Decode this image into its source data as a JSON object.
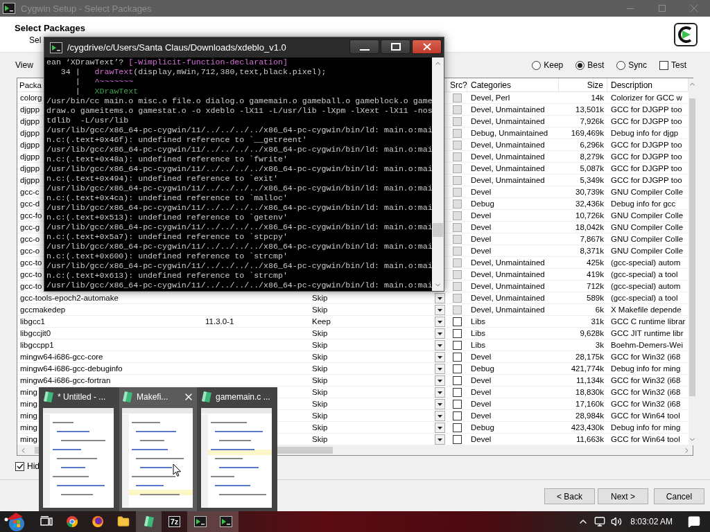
{
  "background_window": {
    "title": "Cygwin Setup - Select Packages"
  },
  "header": {
    "title": "Select Packages",
    "subtitle": "Sel"
  },
  "view_label": "View",
  "modes": [
    {
      "label": "Keep",
      "selected": false
    },
    {
      "label": "Best",
      "selected": true
    },
    {
      "label": "Sync",
      "selected": false
    }
  ],
  "test": {
    "label": "Test",
    "checked": false
  },
  "table": {
    "columns": [
      "Packa",
      "Src?",
      "Categories",
      "Size",
      "Description"
    ],
    "rows": [
      {
        "package": "colorg",
        "disabled": true,
        "category": "Devel, Perl",
        "size": "14k",
        "description": "Colorizer for GCC w"
      },
      {
        "package": "djgpp",
        "disabled": true,
        "category": "Devel, Unmaintained",
        "size": "13,501k",
        "description": "GCC for DJGPP too"
      },
      {
        "package": "djgpp",
        "disabled": true,
        "category": "Devel, Unmaintained",
        "size": "7,926k",
        "description": "GCC for DJGPP too"
      },
      {
        "package": "djgpp",
        "disabled": true,
        "category": "Debug, Unmaintained",
        "size": "169,469k",
        "description": "Debug info for djgp"
      },
      {
        "package": "djgpp",
        "disabled": true,
        "category": "Devel, Unmaintained",
        "size": "6,296k",
        "description": "GCC for DJGPP too"
      },
      {
        "package": "djgpp",
        "disabled": true,
        "category": "Devel, Unmaintained",
        "size": "8,279k",
        "description": "GCC for DJGPP too"
      },
      {
        "package": "djgpp",
        "disabled": true,
        "category": "Devel, Unmaintained",
        "size": "5,087k",
        "description": "GCC for DJGPP too"
      },
      {
        "package": "djgpp",
        "disabled": true,
        "category": "Devel, Unmaintained",
        "size": "5,349k",
        "description": "GCC for DJGPP too"
      },
      {
        "package": "gcc-c",
        "disabled": true,
        "category": "Devel",
        "size": "30,739k",
        "description": "GNU Compiler Colle"
      },
      {
        "package": "gcc-d",
        "disabled": true,
        "category": "Debug",
        "size": "32,436k",
        "description": "Debug info for gcc"
      },
      {
        "package": "gcc-fo",
        "disabled": true,
        "category": "Devel",
        "size": "10,726k",
        "description": "GNU Compiler Colle"
      },
      {
        "package": "gcc-g",
        "disabled": true,
        "category": "Devel",
        "size": "18,042k",
        "description": "GNU Compiler Colle"
      },
      {
        "package": "gcc-o",
        "disabled": true,
        "category": "Devel",
        "size": "7,867k",
        "description": "GNU Compiler Colle"
      },
      {
        "package": "gcc-o",
        "disabled": true,
        "category": "Devel",
        "size": "8,371k",
        "description": "GNU Compiler Colle"
      },
      {
        "package": "gcc-to",
        "disabled": true,
        "category": "Devel, Unmaintained",
        "size": "425k",
        "description": "(gcc-special) autom"
      },
      {
        "package": "gcc-to",
        "disabled": true,
        "category": "Devel, Unmaintained",
        "size": "419k",
        "description": "(gcc-special) a tool"
      },
      {
        "package": "gcc-to",
        "disabled": true,
        "category": "Devel, Unmaintained",
        "size": "712k",
        "description": "(gcc-special) autom"
      },
      {
        "package": "gcc-tools-epoch2-automake",
        "new": "Skip",
        "disabled": true,
        "category": "Devel, Unmaintained",
        "size": "589k",
        "description": "(gcc-special) a tool"
      },
      {
        "package": "gccmakedep",
        "new": "Skip",
        "disabled": true,
        "category": "Devel, Unmaintained",
        "size": "6k",
        "description": "X Makefile depende"
      },
      {
        "package": "libgcc1",
        "current": "11.3.0-1",
        "new": "Keep",
        "disabled": false,
        "category": "Libs",
        "size": "31k",
        "description": "GCC C runtime librar"
      },
      {
        "package": "libgccjit0",
        "new": "Skip",
        "disabled": false,
        "category": "Libs",
        "size": "9,628k",
        "description": "GCC JIT runtime libr"
      },
      {
        "package": "libgccpp1",
        "new": "Skip",
        "disabled": false,
        "category": "Libs",
        "size": "3k",
        "description": "Boehm-Demers-Wei"
      },
      {
        "package": "mingw64-i686-gcc-core",
        "new": "Skip",
        "disabled": false,
        "category": "Devel",
        "size": "28,175k",
        "description": "GCC for Win32 (i68"
      },
      {
        "package": "mingw64-i686-gcc-debuginfo",
        "new": "Skip",
        "disabled": false,
        "category": "Debug",
        "size": "421,774k",
        "description": "Debug info for ming"
      },
      {
        "package": "mingw64-i686-gcc-fortran",
        "new": "Skip",
        "disabled": false,
        "category": "Devel",
        "size": "11,134k",
        "description": "GCC for Win32 (i68"
      },
      {
        "package": "ming",
        "new": "Skip",
        "disabled": false,
        "category": "Devel",
        "size": "18,830k",
        "description": "GCC for Win32 (i68"
      },
      {
        "package": "ming",
        "new": "Skip",
        "disabled": false,
        "category": "Devel",
        "size": "17,160k",
        "description": "GCC for Win32 (i68"
      },
      {
        "package": "ming",
        "new": "Skip",
        "disabled": false,
        "category": "Devel",
        "size": "28,984k",
        "description": "GCC for Win64 tool"
      },
      {
        "package": "ming",
        "new": "Skip",
        "disabled": false,
        "category": "Debug",
        "size": "423,430k",
        "description": "Debug info for ming"
      },
      {
        "package": "ming",
        "new": "Skip",
        "disabled": false,
        "category": "Devel",
        "size": "11,663k",
        "description": "GCC for Win64 tool"
      }
    ]
  },
  "hide_obsolete": {
    "label": "Hid",
    "checked": true
  },
  "buttons": [
    "< Back",
    "Next >",
    "Cancel"
  ],
  "terminal": {
    "title": "/cygdrive/c/Users/Santa Claus/Downloads/xdeblo_v1.0",
    "lines": [
      [
        {
          "text": "ean ‘XDrawText’? "
        },
        {
          "text": "[-Wimplicit-function-declaration]",
          "color": "#d670d6"
        }
      ],
      [
        {
          "text": "   34 |   "
        },
        {
          "text": "drawText",
          "color": "#d670d6"
        },
        {
          "text": "(display,mWin,712,380,text,black.pixel);"
        }
      ],
      [
        {
          "text": "      |   "
        },
        {
          "text": "^~~~~~~~",
          "color": "#d670d6"
        }
      ],
      [
        {
          "text": "      |   "
        },
        {
          "text": "XDrawText",
          "color": "#3fa34d"
        }
      ],
      [
        {
          "text": "/usr/bin/cc main.o misc.o file.o dialog.o gamemain.o gameball.o gameblock.o game"
        }
      ],
      [
        {
          "text": "draw.o gameitems.o gamestat.o -o xdeblo -lX11 -L/usr/lib -lXpm -lXext -lX11 -nos"
        }
      ],
      [
        {
          "text": "tdlib  -L/usr/lib"
        }
      ],
      [
        {
          "text": "/usr/lib/gcc/x86_64-pc-cygwin/11/../../../../x86_64-pc-cygwin/bin/ld: main.o:mai"
        }
      ],
      [
        {
          "text": "n.c:(.text+0x46f): undefined reference to `__getreent'"
        }
      ],
      [
        {
          "text": "/usr/lib/gcc/x86_64-pc-cygwin/11/../../../../x86_64-pc-cygwin/bin/ld: main.o:mai"
        }
      ],
      [
        {
          "text": "n.c:(.text+0x48a): undefined reference to `fwrite'"
        }
      ],
      [
        {
          "text": "/usr/lib/gcc/x86_64-pc-cygwin/11/../../../../x86_64-pc-cygwin/bin/ld: main.o:mai"
        }
      ],
      [
        {
          "text": "n.c:(.text+0x494): undefined reference to `exit'"
        }
      ],
      [
        {
          "text": "/usr/lib/gcc/x86_64-pc-cygwin/11/../../../../x86_64-pc-cygwin/bin/ld: main.o:mai"
        }
      ],
      [
        {
          "text": "n.c:(.text+0x4ca): undefined reference to `malloc'"
        }
      ],
      [
        {
          "text": "/usr/lib/gcc/x86_64-pc-cygwin/11/../../../../x86_64-pc-cygwin/bin/ld: main.o:mai"
        }
      ],
      [
        {
          "text": "n.c:(.text+0x513): undefined reference to `getenv'"
        }
      ],
      [
        {
          "text": "/usr/lib/gcc/x86_64-pc-cygwin/11/../../../../x86_64-pc-cygwin/bin/ld: main.o:mai"
        }
      ],
      [
        {
          "text": "n.c:(.text+0x5a7): undefined reference to `stpcpy'"
        }
      ],
      [
        {
          "text": "/usr/lib/gcc/x86_64-pc-cygwin/11/../../../../x86_64-pc-cygwin/bin/ld: main.o:mai"
        }
      ],
      [
        {
          "text": "n.c:(.text+0x600): undefined reference to `strcmp'"
        }
      ],
      [
        {
          "text": "/usr/lib/gcc/x86_64-pc-cygwin/11/../../../../x86_64-pc-cygwin/bin/ld: main.o:mai"
        }
      ],
      [
        {
          "text": "n.c:(.text+0x613): undefined reference to `strcmp'"
        }
      ],
      [
        {
          "text": "/usr/lib/gcc/x86_64-pc-cygwin/11/../../../../x86_64-pc-cygwin/bin/ld: main.o:mai"
        }
      ]
    ]
  },
  "task_previews": [
    {
      "title": "* Untitled - ...",
      "hovered": false
    },
    {
      "title": "Makefi...",
      "hovered": true
    },
    {
      "title": "gamemain.c ...",
      "hovered": false
    }
  ],
  "taskbar": {
    "apps": [
      {
        "kind": "start",
        "highlighted": false
      },
      {
        "kind": "task_view",
        "highlighted": false
      },
      {
        "kind": "chrome",
        "highlighted": false
      },
      {
        "kind": "firefox",
        "highlighted": false
      },
      {
        "kind": "explorer",
        "highlighted": false
      },
      {
        "kind": "notepad",
        "highlighted": true
      },
      {
        "kind": "archive",
        "label": "7z",
        "highlighted": false
      },
      {
        "kind": "terminal",
        "highlighted": true
      },
      {
        "kind": "terminal",
        "highlighted": true
      }
    ],
    "clock": "8:03:02 AM"
  }
}
